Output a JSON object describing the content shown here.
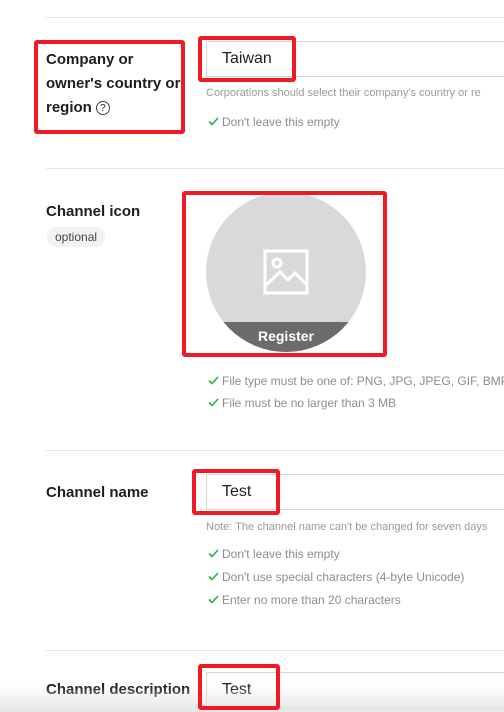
{
  "company": {
    "label_line1": "Company or",
    "label_line2": "owner's country or",
    "label_line3": "region",
    "help_glyph": "?",
    "value": "Taiwan",
    "hint": "Corporations should select their company's country or re",
    "rule": "Don't leave this empty"
  },
  "icon": {
    "label": "Channel icon",
    "optional": "optional",
    "register": "Register",
    "rules": [
      "File type must be one of: PNG, JPG, JPEG, GIF, BMP",
      "File must be no larger than 3 MB"
    ]
  },
  "name": {
    "label": "Channel name",
    "value": "Test",
    "hint": "Note: The channel name can't be changed for seven days",
    "rules": [
      "Don't leave this empty",
      "Don't use special characters (4-byte Unicode)",
      "Enter no more than 20 characters"
    ]
  },
  "description": {
    "label": "Channel description",
    "value": "Test"
  },
  "colors": {
    "annotation": "#ee1b26",
    "check": "#27b24a",
    "register_band": "#6b6b6b"
  }
}
